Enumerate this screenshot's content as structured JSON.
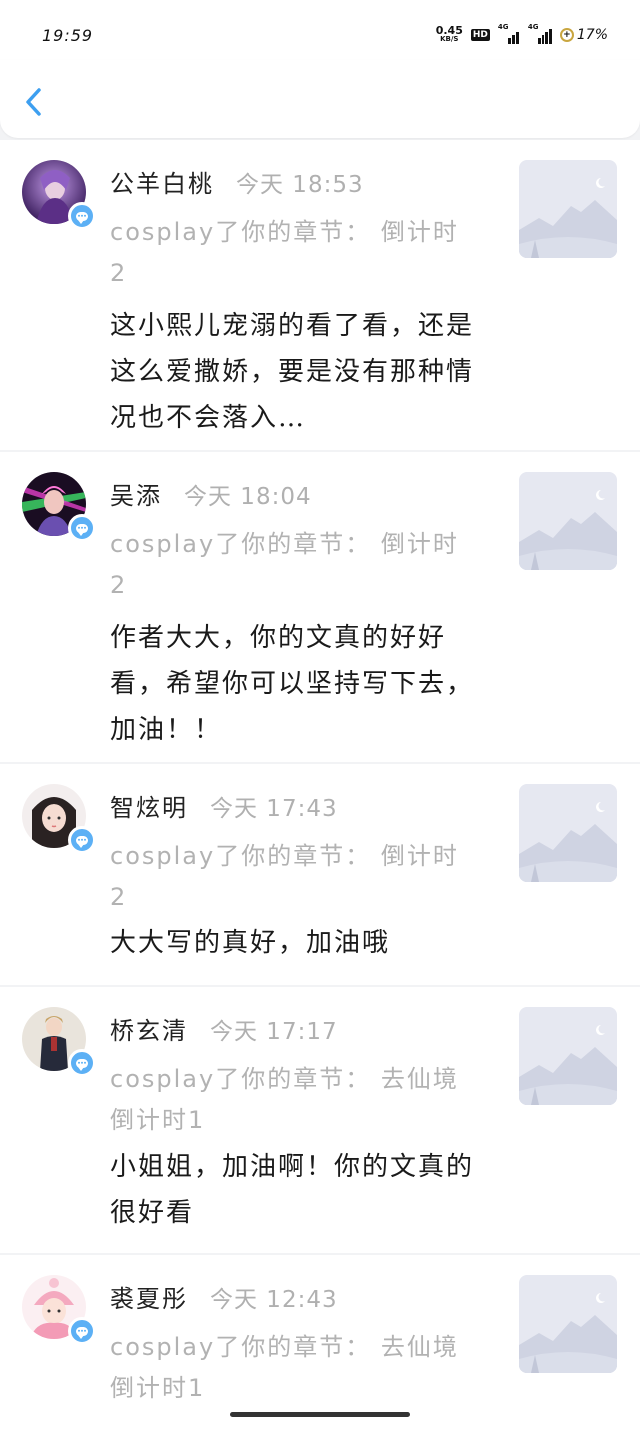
{
  "status_bar": {
    "time": "19:59",
    "net_speed": "0.45",
    "net_unit": "KB/S",
    "hd_label": "HD",
    "sim1_tag": "4G",
    "sim2_tag": "4G",
    "battery_percent": "17%"
  },
  "nav": {
    "back_icon": "chevron-left-icon"
  },
  "notifications": [
    {
      "user": "公羊白桃",
      "time": "今天 18:53",
      "summary": "cosplay了你的章节： 倒计时2",
      "comment": "这小熙儿宠溺的看了看，还是这么爱撒娇，要是没有那种情况也不会落入…"
    },
    {
      "user": "吴添",
      "time": "今天 18:04",
      "summary": "cosplay了你的章节： 倒计时2",
      "comment": "作者大大，你的文真的好好看，希望你可以坚持写下去，加油！！"
    },
    {
      "user": "智炫明",
      "time": "今天 17:43",
      "summary": "cosplay了你的章节： 倒计时2",
      "comment": "大大写的真好，加油哦"
    },
    {
      "user": "桥玄清",
      "time": "今天 17:17",
      "summary": "cosplay了你的章节： 去仙境倒计时1",
      "comment": "小姐姐，加油啊！你的文真的很好看"
    },
    {
      "user": "裘夏彤",
      "time": "今天 12:43",
      "summary": "cosplay了你的章节： 去仙境倒计时1",
      "comment": ""
    }
  ],
  "colors": {
    "accent": "#3d9ff0",
    "badge": "#5cb0f5",
    "muted_text": "#b2b2b2",
    "background": "#f2f3f5"
  }
}
